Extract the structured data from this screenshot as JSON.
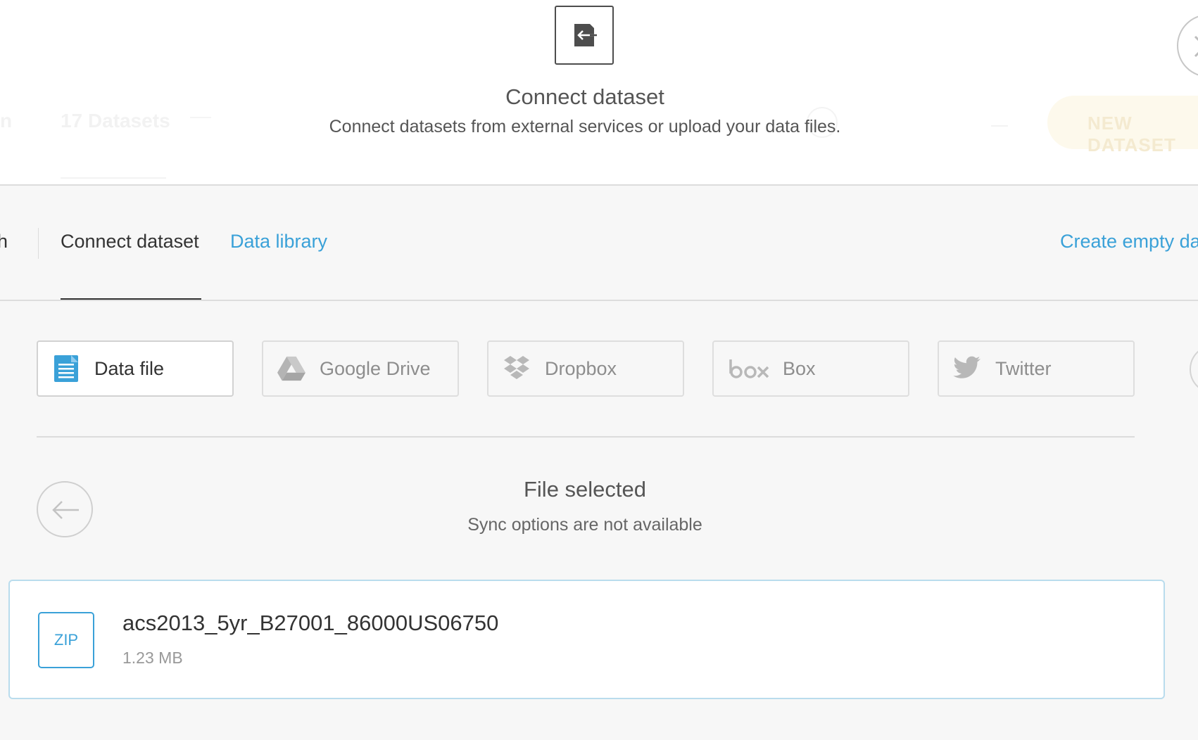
{
  "header": {
    "title": "Connect dataset",
    "subtitle": "Connect datasets from external services or upload your data files.",
    "connect_icon": "connect-dataset-icon",
    "close_icon": "close-icon"
  },
  "background": {
    "count_text": "17 Datasets",
    "cut_letter": "n",
    "button_label": "NEW DATASET"
  },
  "tabs": {
    "cut_label": "h",
    "connect": "Connect dataset",
    "library": "Data library",
    "create": "Create empty dataset"
  },
  "sources": [
    {
      "label": "Data file",
      "icon": "document-icon",
      "active": true
    },
    {
      "label": "Google Drive",
      "icon": "google-drive-icon",
      "active": false
    },
    {
      "label": "Dropbox",
      "icon": "dropbox-icon",
      "active": false
    },
    {
      "label": "Box",
      "icon": "box-icon",
      "active": false
    },
    {
      "label": "Twitter",
      "icon": "twitter-icon",
      "active": false
    }
  ],
  "selection": {
    "title": "File selected",
    "subtitle": "Sync options are not available"
  },
  "file": {
    "badge": "ZIP",
    "name": "acs2013_5yr_B27001_86000US06750",
    "size": "1.23 MB"
  },
  "colors": {
    "accent": "#3aa1d8",
    "text": "#333333",
    "muted": "#8d8d8d",
    "background": "#f7f7f7"
  }
}
